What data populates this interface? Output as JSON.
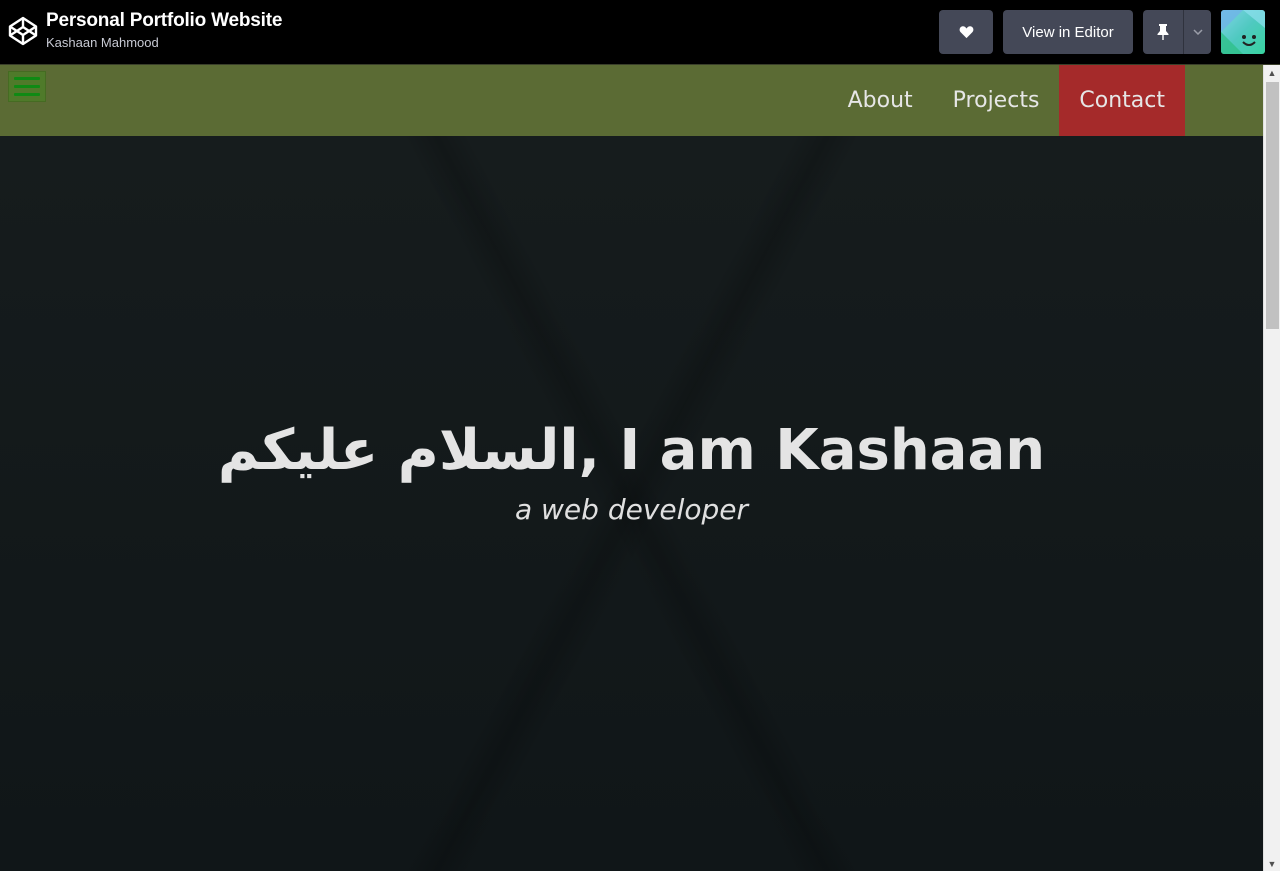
{
  "header": {
    "title": "Personal Portfolio Website",
    "author": "Kashaan Mahmood",
    "view_in_editor": "View in Editor",
    "icons": {
      "logo": "codepen-logo-icon",
      "heart": "heart-icon",
      "pin": "pin-icon",
      "dropdown": "chevron-down-icon",
      "avatar": "avatar"
    }
  },
  "navbar": {
    "links": [
      {
        "label": "About"
      },
      {
        "label": "Projects"
      },
      {
        "label": "Contact"
      }
    ],
    "active_color": "#a52a2a",
    "bar_color": "#5b6b34"
  },
  "hero": {
    "heading": "السلام عليكم, I am Kashaan",
    "subheading": "a web developer"
  }
}
